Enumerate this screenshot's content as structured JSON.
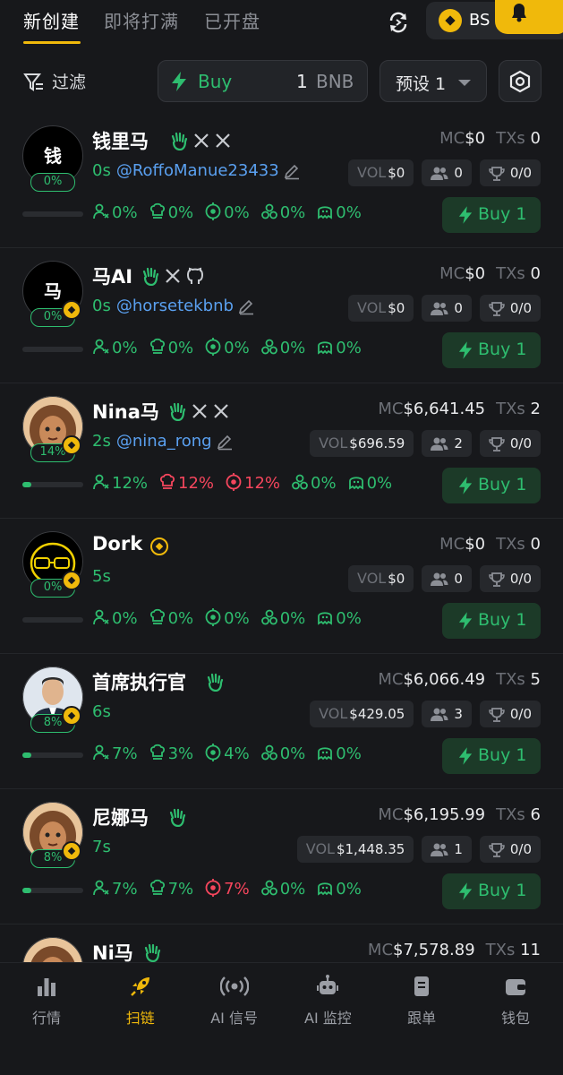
{
  "tabs": [
    {
      "label": "新创建",
      "active": true
    },
    {
      "label": "即将打满",
      "active": false
    },
    {
      "label": "已开盘",
      "active": false
    }
  ],
  "chain": {
    "label": "BS"
  },
  "filter": {
    "label": "过滤"
  },
  "buy_box": {
    "label": "Buy",
    "amount": "1",
    "unit": "BNB"
  },
  "preset": {
    "label": "预设 1"
  },
  "colors": {
    "accent": "#f0b90b",
    "green": "#2ebd6f",
    "red": "#f6465d",
    "link": "#5aa0f0",
    "bg": "#17181b"
  },
  "labels": {
    "mc": "MC",
    "txs": "TXs",
    "vol": "VOL",
    "buy": "Buy 1"
  },
  "tokens": [
    {
      "name": "钱里马",
      "avatar_text": "钱",
      "avatar_style": "black",
      "pct": "0%",
      "progress": 0,
      "socials": [
        "hand-icon",
        "x-icon",
        "x-icon"
      ],
      "age": "0s",
      "handle": "@RoffoManue23433",
      "editable": true,
      "mc": "$0",
      "txs": "0",
      "vol": "$0",
      "holders": "0",
      "trophy": "0/0",
      "bnb_badge": false,
      "stats": [
        {
          "icon": "holders-icon",
          "value": "0%",
          "color": "green"
        },
        {
          "icon": "chef-icon",
          "value": "0%",
          "color": "green"
        },
        {
          "icon": "target-icon",
          "value": "0%",
          "color": "green"
        },
        {
          "icon": "cluster-icon",
          "value": "0%",
          "color": "green"
        },
        {
          "icon": "ghost-icon",
          "value": "0%",
          "color": "green"
        }
      ]
    },
    {
      "name": "马AI",
      "avatar_text": "马",
      "avatar_style": "black",
      "pct": "0%",
      "progress": 0,
      "socials": [
        "hand-icon",
        "x-icon",
        "github-icon"
      ],
      "age": "0s",
      "handle": "@horsetekbnb",
      "editable": true,
      "mc": "$0",
      "txs": "0",
      "vol": "$0",
      "holders": "0",
      "trophy": "0/0",
      "bnb_badge": true,
      "stats": [
        {
          "icon": "holders-icon",
          "value": "0%",
          "color": "green"
        },
        {
          "icon": "chef-icon",
          "value": "0%",
          "color": "green"
        },
        {
          "icon": "target-icon",
          "value": "0%",
          "color": "green"
        },
        {
          "icon": "cluster-icon",
          "value": "0%",
          "color": "green"
        },
        {
          "icon": "ghost-icon",
          "value": "0%",
          "color": "green"
        }
      ]
    },
    {
      "name": "Nina马",
      "avatar_text": "",
      "avatar_style": "cartoon",
      "pct": "14%",
      "progress": 0.14,
      "socials": [
        "hand-icon",
        "x-icon",
        "x-icon"
      ],
      "age": "2s",
      "handle": "@nina_rong",
      "editable": true,
      "mc": "$6,641.45",
      "txs": "2",
      "vol": "$696.59",
      "holders": "2",
      "trophy": "0/0",
      "bnb_badge": true,
      "stats": [
        {
          "icon": "holders-icon",
          "value": "12%",
          "color": "green"
        },
        {
          "icon": "chef-icon",
          "value": "12%",
          "color": "red"
        },
        {
          "icon": "target-icon",
          "value": "12%",
          "color": "red"
        },
        {
          "icon": "cluster-icon",
          "value": "0%",
          "color": "green"
        },
        {
          "icon": "ghost-icon",
          "value": "0%",
          "color": "green"
        }
      ]
    },
    {
      "name": "Dork",
      "avatar_text": "",
      "avatar_style": "dork",
      "pct": "0%",
      "progress": 0,
      "socials": [
        "coin-icon"
      ],
      "age": "5s",
      "handle": "",
      "editable": false,
      "mc": "$0",
      "txs": "0",
      "vol": "$0",
      "holders": "0",
      "trophy": "0/0",
      "bnb_badge": true,
      "stats": [
        {
          "icon": "holders-icon",
          "value": "0%",
          "color": "green"
        },
        {
          "icon": "chef-icon",
          "value": "0%",
          "color": "green"
        },
        {
          "icon": "target-icon",
          "value": "0%",
          "color": "green"
        },
        {
          "icon": "cluster-icon",
          "value": "0%",
          "color": "green"
        },
        {
          "icon": "ghost-icon",
          "value": "0%",
          "color": "green"
        }
      ]
    },
    {
      "name": "首席执行官",
      "avatar_text": "",
      "avatar_style": "person",
      "pct": "8%",
      "progress": 0.08,
      "socials": [
        "hand-icon"
      ],
      "age": "6s",
      "handle": "",
      "editable": false,
      "mc": "$6,066.49",
      "txs": "5",
      "vol": "$429.05",
      "holders": "3",
      "trophy": "0/0",
      "bnb_badge": true,
      "stats": [
        {
          "icon": "holders-icon",
          "value": "7%",
          "color": "green"
        },
        {
          "icon": "chef-icon",
          "value": "3%",
          "color": "green"
        },
        {
          "icon": "target-icon",
          "value": "4%",
          "color": "green"
        },
        {
          "icon": "cluster-icon",
          "value": "0%",
          "color": "green"
        },
        {
          "icon": "ghost-icon",
          "value": "0%",
          "color": "green"
        }
      ]
    },
    {
      "name": "尼娜马",
      "avatar_text": "",
      "avatar_style": "cartoon",
      "pct": "8%",
      "progress": 0.08,
      "socials": [
        "hand-icon"
      ],
      "age": "7s",
      "handle": "",
      "editable": false,
      "mc": "$6,195.99",
      "txs": "6",
      "vol": "$1,448.35",
      "holders": "1",
      "trophy": "0/0",
      "bnb_badge": true,
      "stats": [
        {
          "icon": "holders-icon",
          "value": "7%",
          "color": "green"
        },
        {
          "icon": "chef-icon",
          "value": "7%",
          "color": "green"
        },
        {
          "icon": "target-icon",
          "value": "7%",
          "color": "red"
        },
        {
          "icon": "cluster-icon",
          "value": "0%",
          "color": "green"
        },
        {
          "icon": "ghost-icon",
          "value": "0%",
          "color": "green"
        }
      ]
    },
    {
      "name": "Ni马",
      "avatar_text": "",
      "avatar_style": "cartoon",
      "pct": "",
      "progress": 0,
      "socials": [
        "hand-icon"
      ],
      "age": "",
      "handle": "",
      "editable": false,
      "mc": "$7,578.89",
      "txs": "11",
      "vol": "",
      "holders": "",
      "trophy": "",
      "bnb_badge": false,
      "stats": []
    }
  ],
  "nav": [
    {
      "label": "行情",
      "icon": "bar-chart-icon",
      "active": false
    },
    {
      "label": "扫链",
      "icon": "rocket-icon",
      "active": true
    },
    {
      "label": "AI 信号",
      "icon": "signal-icon",
      "active": false
    },
    {
      "label": "AI 监控",
      "icon": "robot-icon",
      "active": false
    },
    {
      "label": "跟单",
      "icon": "document-icon",
      "active": false
    },
    {
      "label": "钱包",
      "icon": "wallet-icon",
      "active": false
    }
  ]
}
